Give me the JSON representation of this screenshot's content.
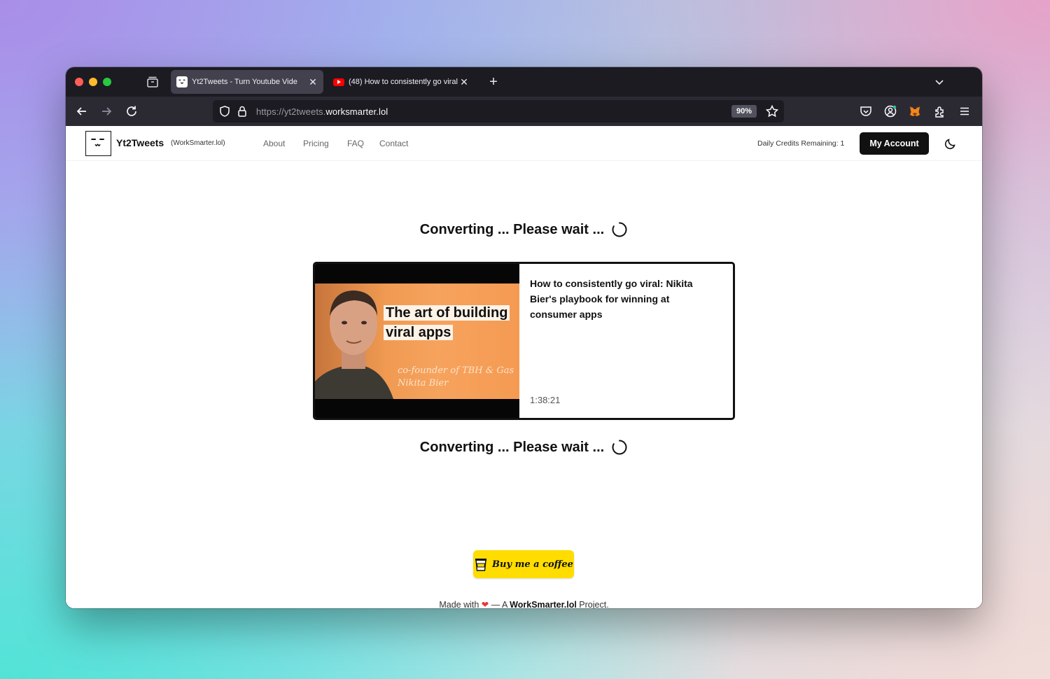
{
  "browser": {
    "tabs": [
      {
        "title": "Yt2Tweets - Turn Youtube Vide",
        "active": true
      },
      {
        "title": "(48) How to consistently go viral",
        "active": false
      }
    ],
    "url": {
      "prefix": "https://yt2tweets.",
      "host": "worksmarter.lol"
    },
    "zoom": "90%"
  },
  "site": {
    "brand": "Yt2Tweets",
    "brand_sub": "(WorkSmarter.lol)",
    "nav": [
      "About",
      "Pricing",
      "FAQ",
      "Contact"
    ],
    "credits": "Daily Credits Remaining: 1",
    "account_label": "My Account"
  },
  "status": {
    "text": "Converting ... Please wait ..."
  },
  "video": {
    "title": "How to consistently go viral: Nikita Bier's playbook for winning at consumer apps",
    "duration": "1:38:21",
    "thumbnail": {
      "headline_line1": "The art of building",
      "headline_line2": "viral apps",
      "sub_line1": "co-founder of TBH & Gas",
      "sub_line2": "Nikita Bier"
    }
  },
  "coffee": {
    "label": "Buy me a coffee",
    "color": "#ffdd00"
  },
  "footer": {
    "prefix": "Made with",
    "dash": " — A ",
    "brand": "WorkSmarter.lol",
    "suffix": " Project."
  }
}
